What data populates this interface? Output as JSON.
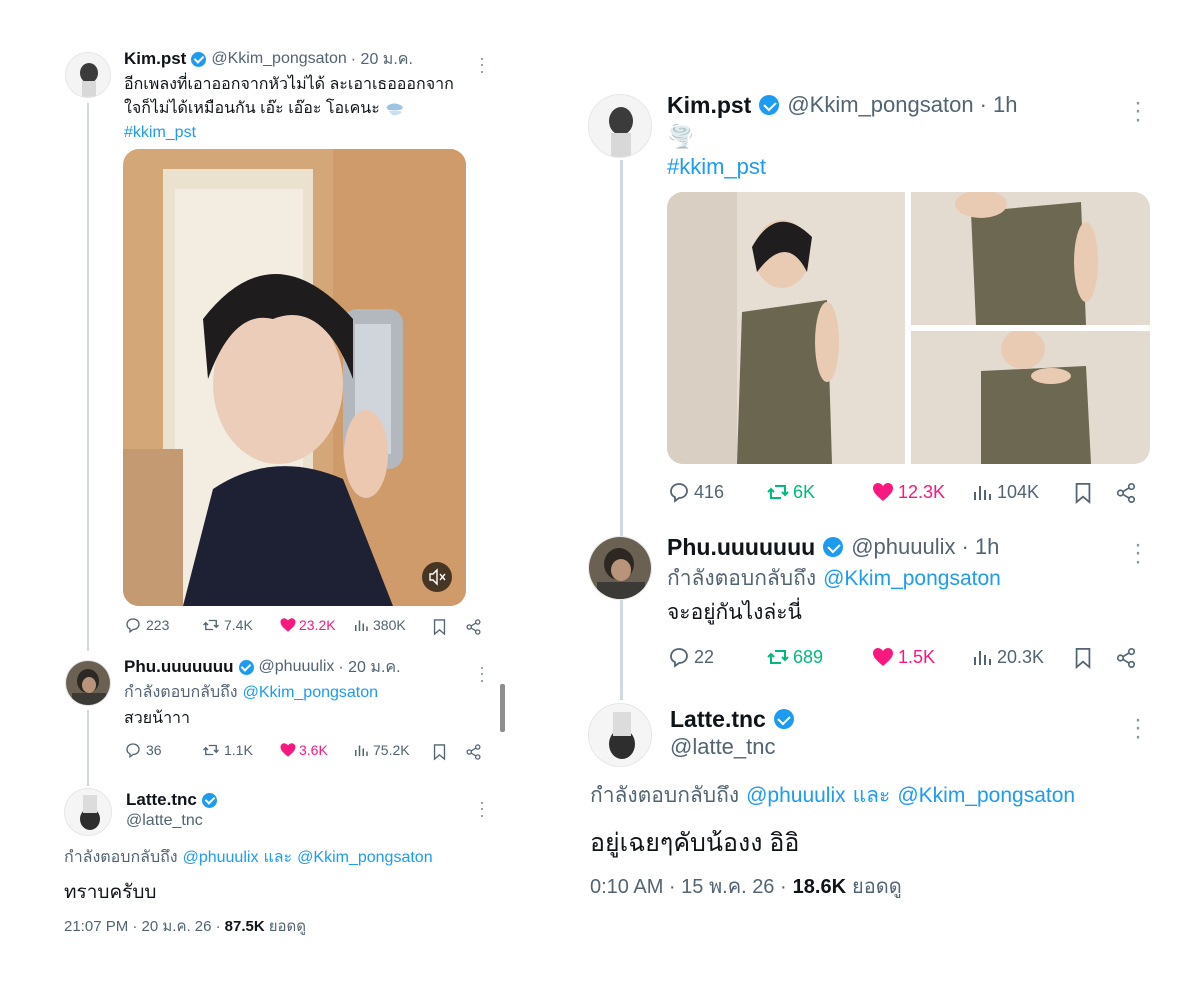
{
  "left": {
    "tweet1": {
      "name": "Kim.pst",
      "handle": "@Kkim_pongsaton",
      "time": "· 20 ม.ค.",
      "text_line1": "อีกเพลงที่เอาออกจากหัวไม่ได้ ละเอาเธอออกจาก",
      "text_line2": "ใจก็ไม่ได้เหมือนกัน เอ๊ะ เอ๊อะ โอเคนะ",
      "hashtag": "#kkim_pst",
      "stats": {
        "replies": "223",
        "reposts": "7.4K",
        "likes": "23.2K",
        "views": "380K"
      }
    },
    "tweet2": {
      "name": "Phu.uuuuuuu",
      "handle": "@phuuulix",
      "time": "· 20 ม.ค.",
      "reply_prefix": "กำลังตอบกลับถึง",
      "reply_to": "@Kkim_pongsaton",
      "text": "สวยน้าาา",
      "stats": {
        "replies": "36",
        "reposts": "1.1K",
        "likes": "3.6K",
        "views": "75.2K"
      }
    },
    "tweet3": {
      "name": "Latte.tnc",
      "handle": "@latte_tnc",
      "reply_prefix": "กำลังตอบกลับถึง",
      "reply_to_1": "@phuuulix",
      "reply_and": "และ",
      "reply_to_2": "@Kkim_pongsaton",
      "text": "ทราบครับบ",
      "footer_time": "21:07 PM · 20 ม.ค. 26 ·",
      "footer_views": "87.5K",
      "footer_views_label": "ยอดดู"
    }
  },
  "right": {
    "tweet1": {
      "name": "Kim.pst",
      "handle": "@Kkim_pongsaton",
      "time": "· 1h",
      "emoji": "🌪️",
      "hashtag": "#kkim_pst",
      "stats": {
        "replies": "416",
        "reposts": "6K",
        "likes": "12.3K",
        "views": "104K"
      }
    },
    "tweet2": {
      "name": "Phu.uuuuuuu",
      "handle": "@phuuulix",
      "time": "· 1h",
      "reply_prefix": "กำลังตอบกลับถึง",
      "reply_to": "@Kkim_pongsaton",
      "text": "จะอยู่กันไงล่ะนี่",
      "stats": {
        "replies": "22",
        "reposts": "689",
        "likes": "1.5K",
        "views": "20.3K"
      }
    },
    "tweet3": {
      "name": "Latte.tnc",
      "handle": "@latte_tnc",
      "reply_prefix": "กำลังตอบกลับถึง",
      "reply_to_1": "@phuuulix",
      "reply_and": "และ",
      "reply_to_2": "@Kkim_pongsaton",
      "text": "อยู่เฉยๆคับน้องง อิอิ",
      "footer_time": "0:10 AM · 15 พ.ค. 26 ·",
      "footer_views": "18.6K",
      "footer_views_label": "ยอดดู"
    }
  },
  "icons": {
    "reply": "reply-icon",
    "repost": "repost-icon",
    "like": "heart-icon",
    "views": "views-icon",
    "bookmark": "bookmark-icon",
    "share": "share-icon",
    "verified": "verified-badge-icon",
    "more": "more-icon",
    "mute": "mute-icon"
  },
  "colors": {
    "link": "#1d9bf0",
    "repost_active": "#00ba7c",
    "like_active": "#f91880",
    "muted_text": "#536471",
    "thread_line": "#cfd9de"
  }
}
